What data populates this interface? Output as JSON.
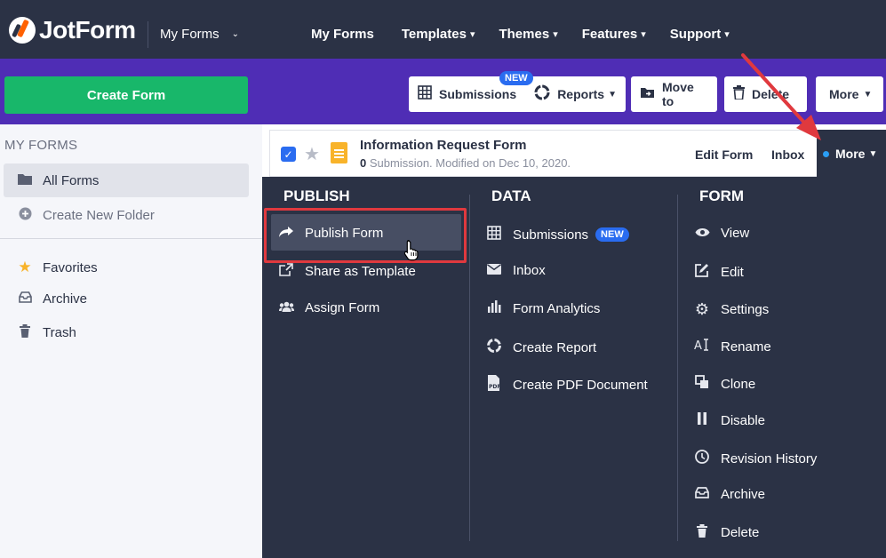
{
  "topbar": {
    "logo_text": "JotForm",
    "myforms_dropdown": "My Forms",
    "nav": [
      {
        "label": "My Forms",
        "caret": ""
      },
      {
        "label": "Templates",
        "caret": "▾"
      },
      {
        "label": "Themes",
        "caret": "▾"
      },
      {
        "label": "Features",
        "caret": "▾"
      },
      {
        "label": "Support",
        "caret": "▾"
      }
    ]
  },
  "toolbar": {
    "create_label": "Create Form",
    "submissions_label": "Submissions",
    "submissions_badge": "NEW",
    "reports_label": "Reports",
    "move_to_label": "Move to",
    "delete_label": "Delete",
    "more_label": "More"
  },
  "sidebar": {
    "title": "MY FORMS",
    "all_forms": "All Forms",
    "create_folder": "Create New Folder",
    "favorites": "Favorites",
    "archive": "Archive",
    "trash": "Trash"
  },
  "form": {
    "title": "Information Request Form",
    "submission_count": "0",
    "meta_text": " Submission. Modified on Dec 10, 2020.",
    "edit_label": "Edit Form",
    "inbox_label": "Inbox",
    "more_label": "More"
  },
  "dropdown": {
    "publish": {
      "title": "PUBLISH",
      "items": [
        "Publish Form",
        "Share as Template",
        "Assign Form"
      ]
    },
    "data": {
      "title": "DATA",
      "items": [
        "Submissions",
        "Inbox",
        "Form Analytics",
        "Create Report",
        "Create PDF Document"
      ],
      "submissions_badge": "NEW"
    },
    "form": {
      "title": "FORM",
      "items": [
        "View",
        "Edit",
        "Settings",
        "Rename",
        "Clone",
        "Disable",
        "Revision History",
        "Archive",
        "Delete"
      ]
    }
  },
  "colors": {
    "topbar": "#2b3245",
    "toolbar": "#4f2db5",
    "create_button": "#18b76a",
    "accent_blue": "#2a6cf0",
    "highlight_red": "#e0393e"
  }
}
